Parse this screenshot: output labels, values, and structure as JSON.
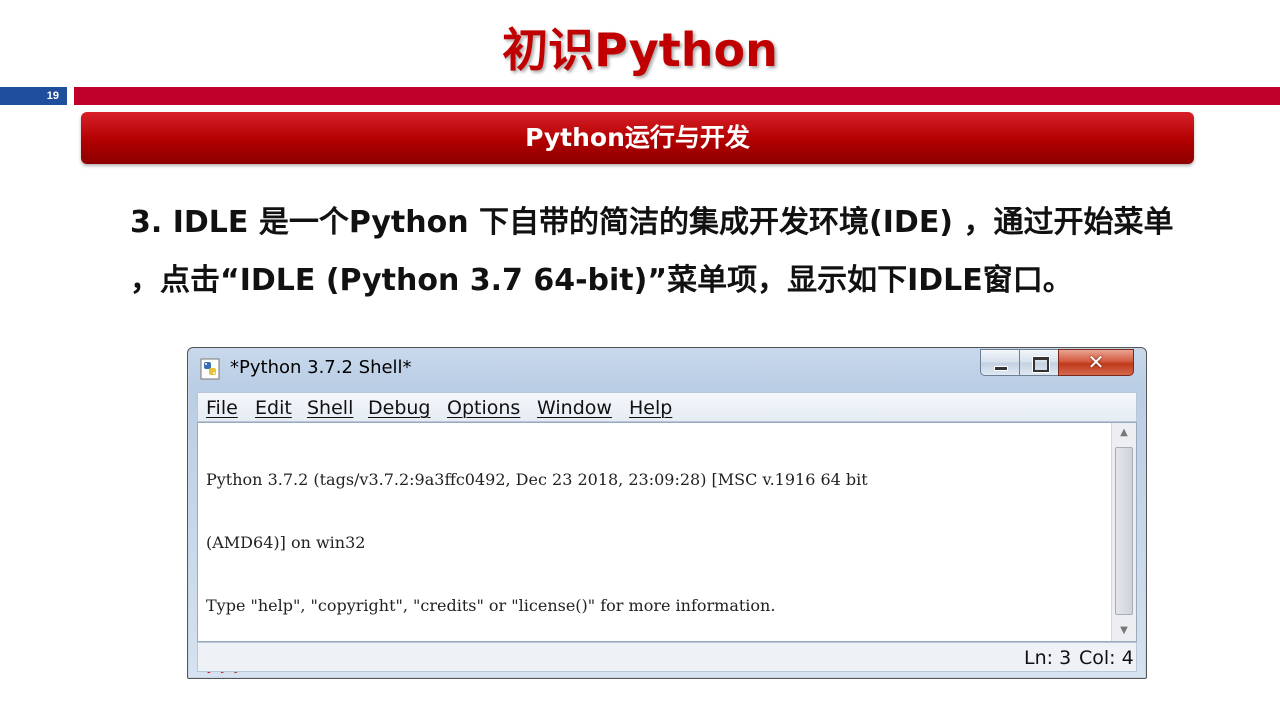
{
  "slide": {
    "title": "初识Python",
    "page_number": "19",
    "section": "Python运行与开发",
    "description_line1": "3. IDLE 是一个Python 下自带的简洁的集成开发环境(IDE) ，通过开始菜单",
    "description_line2": "，点击“IDLE (Python 3.7 64-bit)”菜单项，显示如下IDLE窗口。"
  },
  "window": {
    "title": "*Python 3.7.2 Shell*",
    "controls": {
      "minimize": "minimize",
      "maximize": "maximize",
      "close": "x"
    },
    "menu": [
      "File",
      "Edit",
      "Shell",
      "Debug",
      "Options",
      "Window",
      "Help"
    ],
    "shell": {
      "line1": "Python 3.7.2 (tags/v3.7.2:9a3ffc0492, Dec 23 2018, 23:09:28) [MSC v.1916 64 bit",
      "line2": "(AMD64)] on win32",
      "line3": "Type \"help\", \"copyright\", \"credits\" or \"license()\" for more information.",
      "prompt": ">>>"
    },
    "status": {
      "line": "Ln: 3",
      "col": "Col: 4"
    }
  }
}
